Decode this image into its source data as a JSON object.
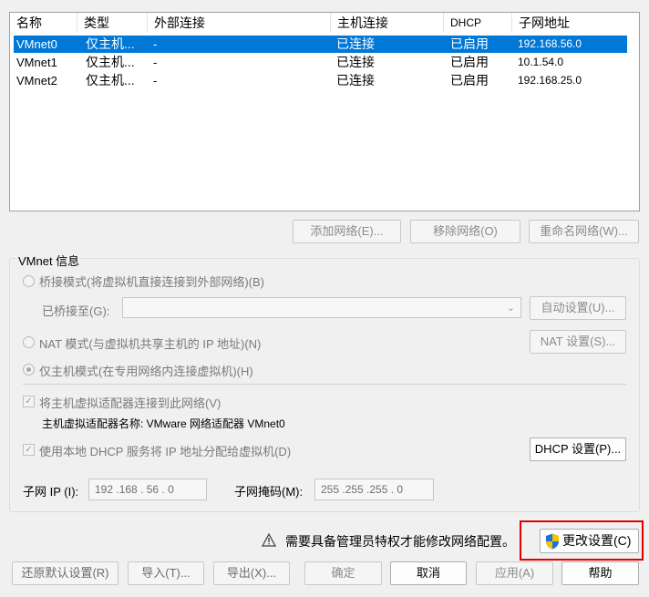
{
  "table": {
    "columns": [
      "名称",
      "类型",
      "外部连接",
      "主机连接",
      "DHCP",
      "子网地址"
    ],
    "rows": [
      {
        "name": "VMnet0",
        "type": "仅主机...",
        "external": "-",
        "host": "已连接",
        "dhcp": "已启用",
        "subnet": "192.168.56.0",
        "selected": true
      },
      {
        "name": "VMnet1",
        "type": "仅主机...",
        "external": "-",
        "host": "已连接",
        "dhcp": "已启用",
        "subnet": "10.1.54.0",
        "selected": false
      },
      {
        "name": "VMnet2",
        "type": "仅主机...",
        "external": "-",
        "host": "已连接",
        "dhcp": "已启用",
        "subnet": "192.168.25.0",
        "selected": false
      }
    ]
  },
  "net_buttons": {
    "add": "添加网络(E)...",
    "remove": "移除网络(O)",
    "rename": "重命名网络(W)..."
  },
  "vmnet_info": {
    "title": "VMnet 信息",
    "bridged_label": "桥接模式(将虚拟机直接连接到外部网络)(B)",
    "bridged_to_label": "已桥接至(G):",
    "bridged_to_value": "",
    "auto_button": "自动设置(U)...",
    "nat_label": "NAT 模式(与虚拟机共享主机的 IP 地址)(N)",
    "nat_button": "NAT 设置(S)...",
    "host_only_label": "仅主机模式(在专用网络内连接虚拟机)(H)",
    "connect_adapter_label": "将主机虚拟适配器连接到此网络(V)",
    "adapter_name_label": "主机虚拟适配器名称: VMware 网络适配器 VMnet0",
    "dhcp_label": "使用本地 DHCP 服务将 IP 地址分配给虚拟机(D)",
    "dhcp_button": "DHCP 设置(P)...",
    "subnet_ip_label": "子网 IP (I):",
    "subnet_ip_value": "192 .168 . 56  .  0",
    "subnet_mask_label": "子网掩码(M):",
    "subnet_mask_value": "255 .255 .255 .  0"
  },
  "admin_notice": "需要具备管理员特权才能修改网络配置。",
  "change_settings_button": "更改设置(C)",
  "bottom_buttons": {
    "restore": "还原默认设置(R)",
    "import": "导入(T)...",
    "export": "导出(X)...",
    "ok": "确定",
    "cancel": "取消",
    "apply": "应用(A)",
    "help": "帮助"
  },
  "icons": {
    "warning": "warning-icon",
    "shield": "uac-shield-icon"
  },
  "colors": {
    "selection": "#0078d7",
    "highlight_box": "#e00000"
  }
}
